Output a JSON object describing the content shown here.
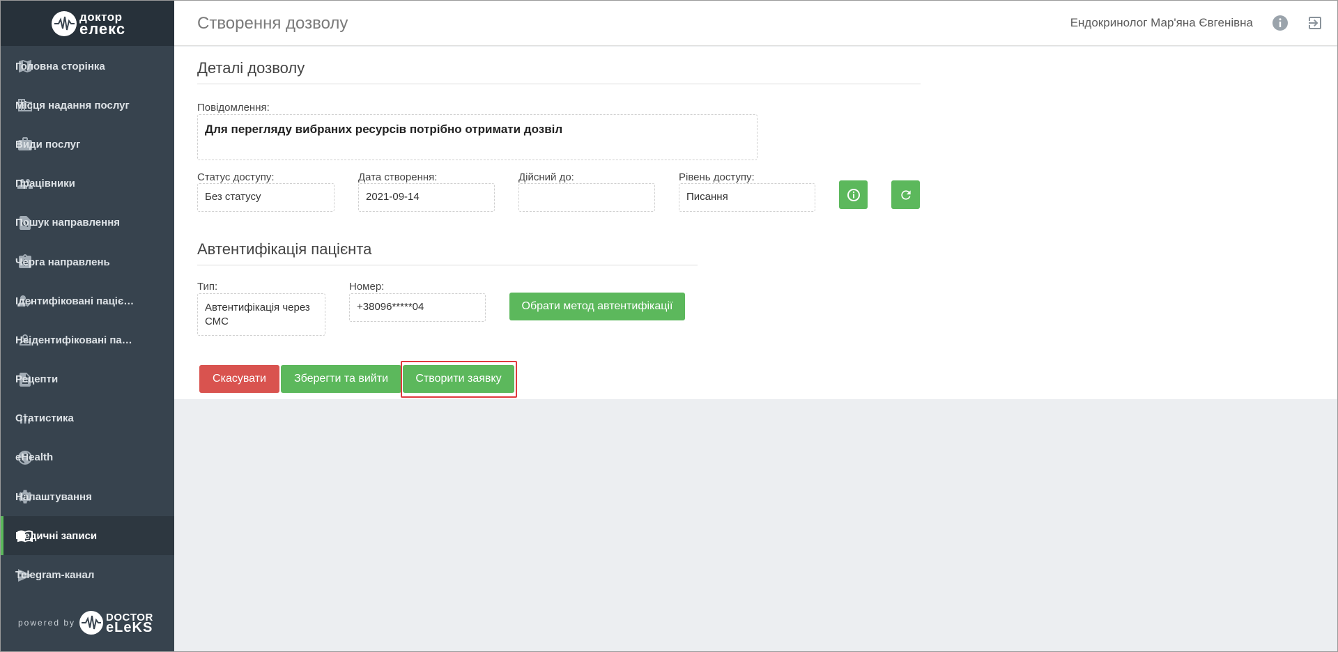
{
  "brand": {
    "logo_line1": "доктор",
    "logo_line2": "елекс",
    "powered_by": "powered by",
    "footer_line1": "DOCTOR",
    "footer_line2": "eLeKS"
  },
  "sidebar": {
    "items": [
      {
        "label": "Головна сторінка",
        "icon": "map-icon"
      },
      {
        "label": "Місця надання послуг",
        "icon": "building-icon"
      },
      {
        "label": "Види послуг",
        "icon": "briefcase-icon"
      },
      {
        "label": "Працівники",
        "icon": "people-icon"
      },
      {
        "label": "Пошук направлення",
        "icon": "search-document-icon"
      },
      {
        "label": "Черга направлень",
        "icon": "clipboard-arrow-icon"
      },
      {
        "label": "Ідентифіковані пацієнти",
        "icon": "person-check-icon"
      },
      {
        "label": "Неідентифіковані пацієнти",
        "icon": "person-outline-icon"
      },
      {
        "label": "Рецепти",
        "icon": "document-icon"
      },
      {
        "label": "Статистика",
        "icon": "bar-chart-icon"
      },
      {
        "label": "eHealth",
        "icon": "globe-icon"
      },
      {
        "label": "Налаштування",
        "icon": "gear-icon"
      },
      {
        "label": "Медичні записи",
        "icon": "book-icon"
      },
      {
        "label": "Telegram-канал",
        "icon": "send-icon"
      }
    ],
    "active_index": 12
  },
  "header": {
    "title": "Створення дозволу",
    "user": "Ендокринолог Мар'яна Євгенівна"
  },
  "details": {
    "title": "Деталі дозволу",
    "message_label": "Повідомлення:",
    "message": "Для перегляду вибраних ресурсів потрібно отримати дозвіл",
    "status_label": "Статус доступу:",
    "status_value": "Без статусу",
    "created_label": "Дата створення:",
    "created_value": "2021-09-14",
    "valid_label": "Дійсний до:",
    "valid_value": "",
    "level_label": "Рівень доступу:",
    "level_value": "Писання"
  },
  "auth": {
    "title": "Автентифікація пацієнта",
    "type_label": "Тип:",
    "type_value": "Автентифікація через СМС",
    "number_label": "Номер:",
    "number_value": "+38096*****04",
    "choose_button": "Обрати метод автентифікації"
  },
  "actions": {
    "cancel": "Скасувати",
    "save_exit": "Зберегти та вийти",
    "create_request": "Створити заявку"
  },
  "colors": {
    "sidebar_bg": "#37434e",
    "accent_green": "#5cb85c",
    "danger_red": "#d9534f",
    "highlight": "#e0393e"
  }
}
